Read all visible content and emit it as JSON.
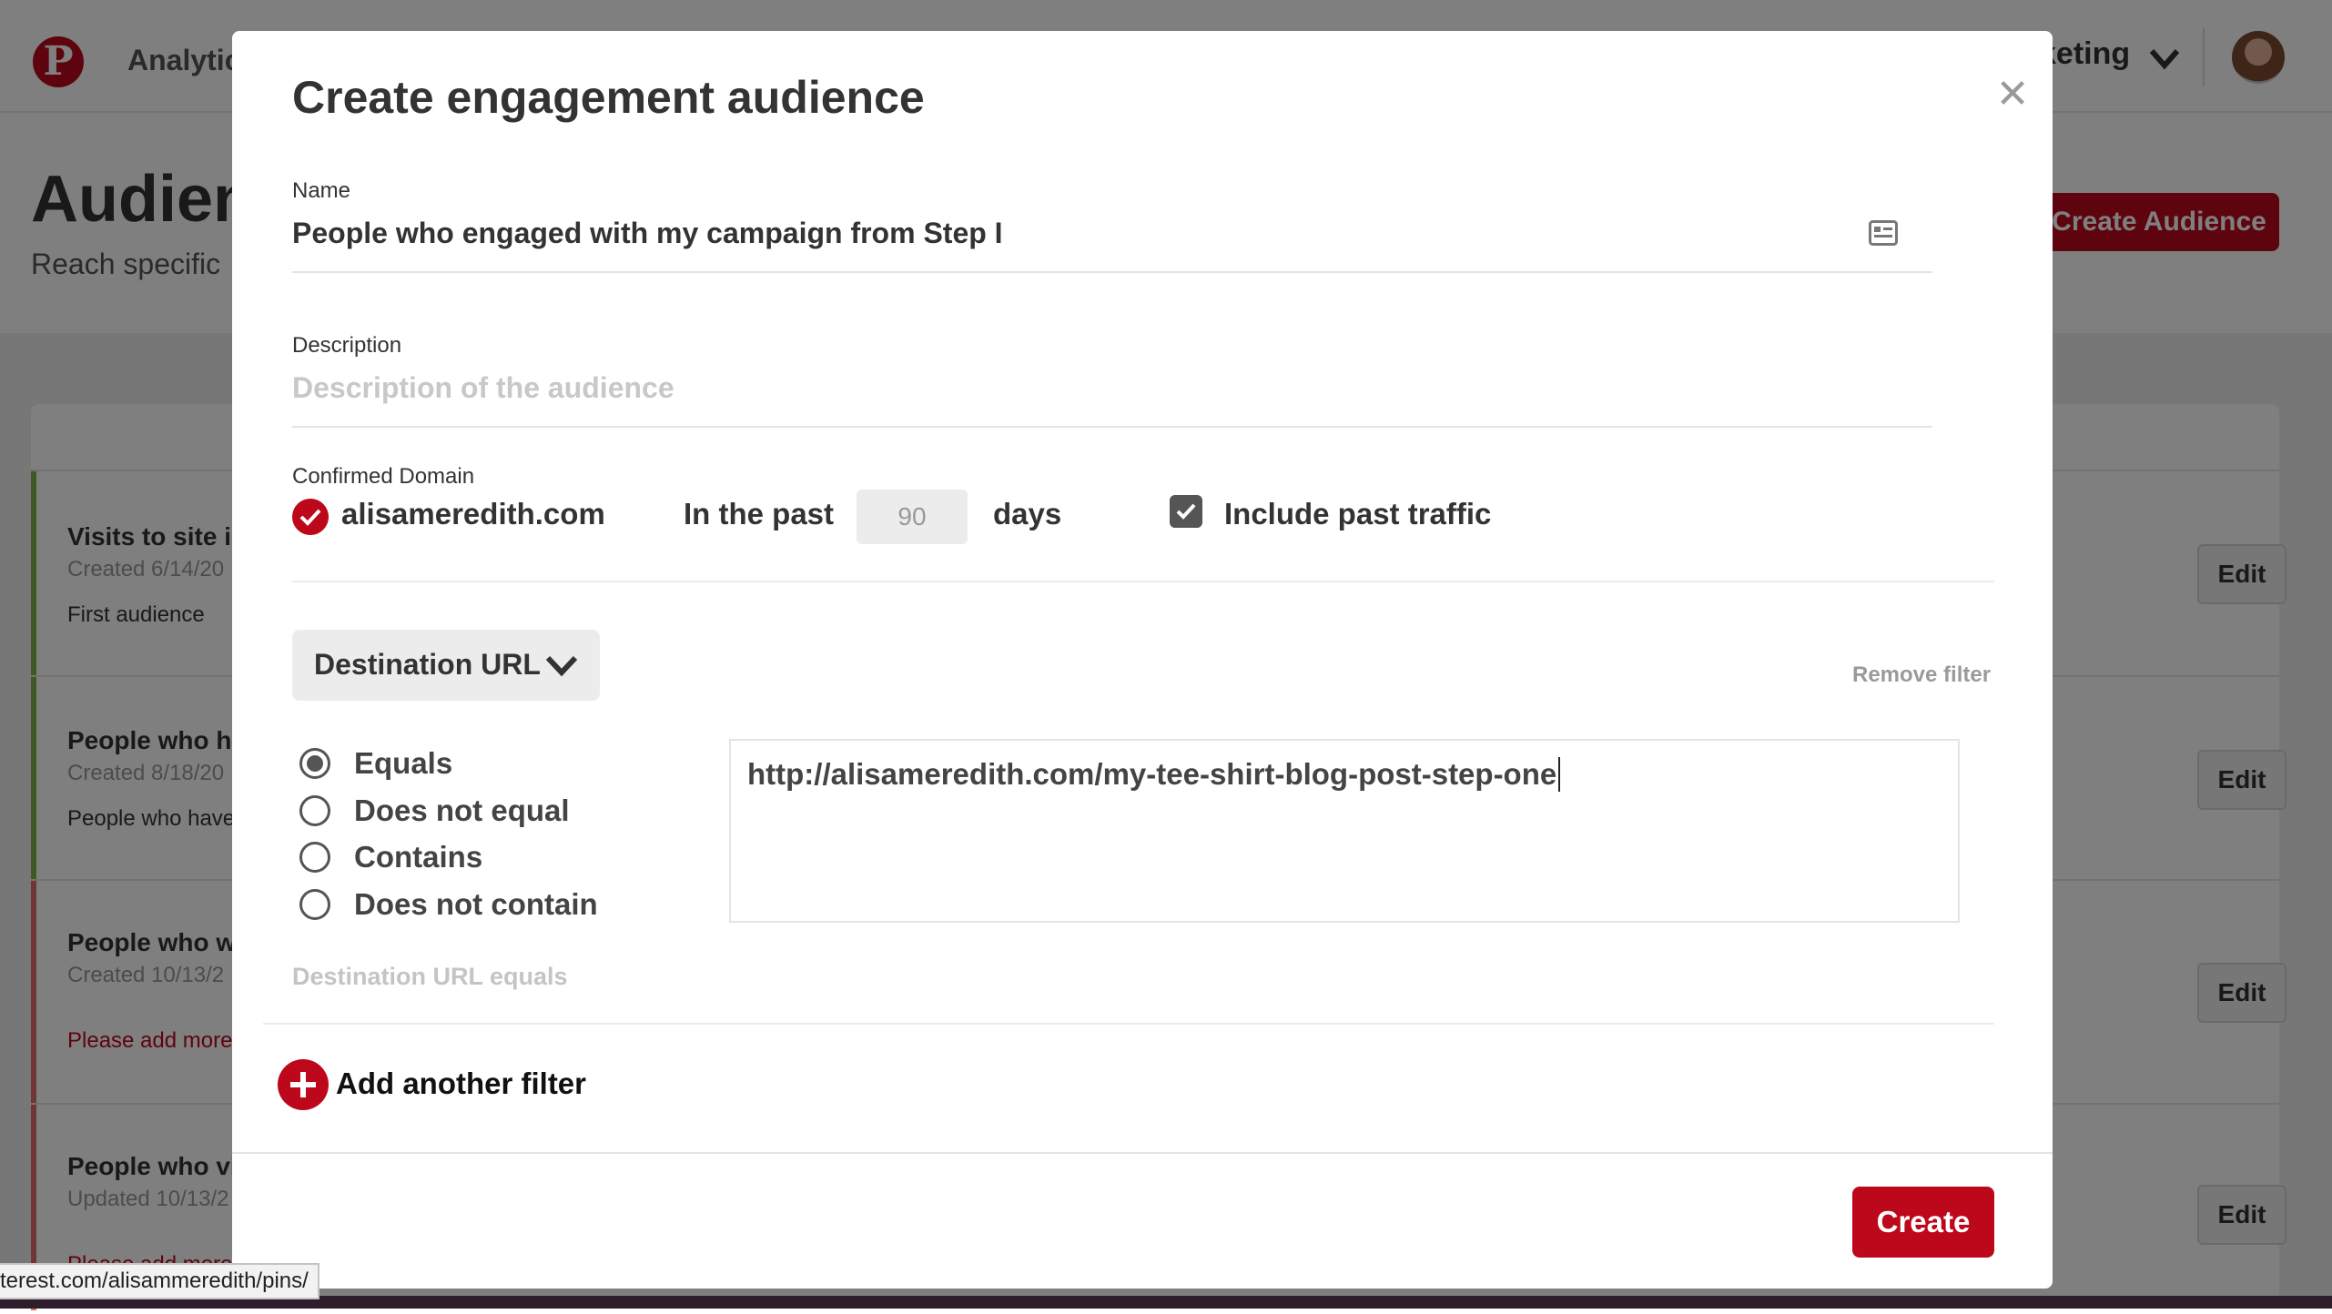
{
  "background": {
    "nav": {
      "analytics_label": "Analytic",
      "account_label": "keting"
    },
    "page_title": "Audien",
    "page_subtitle": "Reach specific",
    "create_audience_label": "Create Audience",
    "rows": [
      {
        "title": "Visits to site ir",
        "date": "Created 6/14/20",
        "desc": "First audience",
        "status": "green",
        "edit": "Edit"
      },
      {
        "title": "People who ha",
        "date": "Created 8/18/20",
        "desc": "People who have",
        "status": "green",
        "edit": "Edit"
      },
      {
        "title": "People who w",
        "date": "Created 10/13/2",
        "desc": "Please add more",
        "status": "red",
        "edit": "Edit"
      },
      {
        "title": "People who vi",
        "date": "Updated 10/13/2",
        "desc": "Please add more",
        "status": "red",
        "edit": "Edit"
      }
    ],
    "status_url": "terest.com/alisammeredith/pins/"
  },
  "modal": {
    "title": "Create engagement audience",
    "close_icon": "close-icon",
    "name": {
      "label": "Name",
      "value": "People who engaged with my campaign from Step I"
    },
    "description": {
      "label": "Description",
      "placeholder": "Description of the audience"
    },
    "domain": {
      "label": "Confirmed Domain",
      "value": "alisameredith.com",
      "in_the_past": "In the past",
      "days_value": "90",
      "days_label": "days",
      "include_past_traffic": "Include past traffic",
      "include_past_traffic_checked": true
    },
    "filter": {
      "field": "Destination URL",
      "remove_label": "Remove filter",
      "options": [
        "Equals",
        "Does not equal",
        "Contains",
        "Does not contain"
      ],
      "selected": "Equals",
      "url_value": "http://alisameredith.com/my-tee-shirt-blog-post-step-one",
      "hint": "Destination URL equals"
    },
    "add_filter_label": "Add another filter",
    "create_label": "Create"
  },
  "colors": {
    "brand": "#bd081c",
    "overlay": "rgba(0,0,0,0.5)"
  }
}
